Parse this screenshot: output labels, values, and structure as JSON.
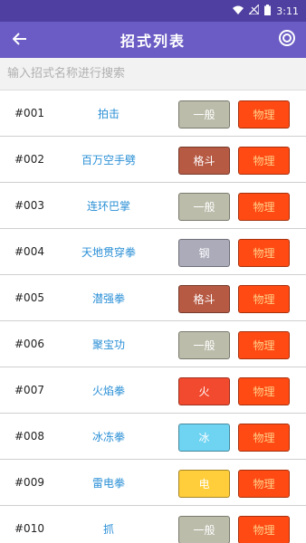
{
  "status_bar": {
    "time": "3:11",
    "icons": [
      "wifi-icon",
      "signal-off-icon",
      "battery-icon"
    ]
  },
  "app_bar": {
    "title": "招式列表",
    "back_icon": "arrow-left-icon",
    "action_icon": "target-icon"
  },
  "search": {
    "placeholder": "输入招式名称进行搜索",
    "value": ""
  },
  "colors": {
    "status_bar": "#4f3fa0",
    "app_bar": "#6a5cc4",
    "name_text": "#2a8fd6",
    "physical": "#ff4a13",
    "physical_text": "#ffd08a"
  },
  "moves": [
    {
      "id": "#001",
      "name": "拍击",
      "type": "一般",
      "type_bg": "#bcbcab",
      "type_fg": "#ffffff",
      "kind": "物理"
    },
    {
      "id": "#002",
      "name": "百万空手劈",
      "type": "格斗",
      "type_bg": "#b65a44",
      "type_fg": "#ffffff",
      "kind": "物理"
    },
    {
      "id": "#003",
      "name": "连环巴掌",
      "type": "一般",
      "type_bg": "#bcbcab",
      "type_fg": "#ffffff",
      "kind": "物理"
    },
    {
      "id": "#004",
      "name": "天地贯穿拳",
      "type": "钢",
      "type_bg": "#ababba",
      "type_fg": "#ffffff",
      "kind": "物理"
    },
    {
      "id": "#005",
      "name": "潜强拳",
      "type": "格斗",
      "type_bg": "#b65a44",
      "type_fg": "#ffffff",
      "kind": "物理"
    },
    {
      "id": "#006",
      "name": "聚宝功",
      "type": "一般",
      "type_bg": "#bcbcab",
      "type_fg": "#ffffff",
      "kind": "物理"
    },
    {
      "id": "#007",
      "name": "火焰拳",
      "type": "火",
      "type_bg": "#f24a2e",
      "type_fg": "#ffffff",
      "kind": "物理"
    },
    {
      "id": "#008",
      "name": "冰冻拳",
      "type": "冰",
      "type_bg": "#6fd3f2",
      "type_fg": "#ffffff",
      "kind": "物理"
    },
    {
      "id": "#009",
      "name": "雷电拳",
      "type": "电",
      "type_bg": "#ffce3a",
      "type_fg": "#ffffff",
      "kind": "物理"
    },
    {
      "id": "#010",
      "name": "抓",
      "type": "一般",
      "type_bg": "#bcbcab",
      "type_fg": "#ffffff",
      "kind": "物理"
    }
  ]
}
